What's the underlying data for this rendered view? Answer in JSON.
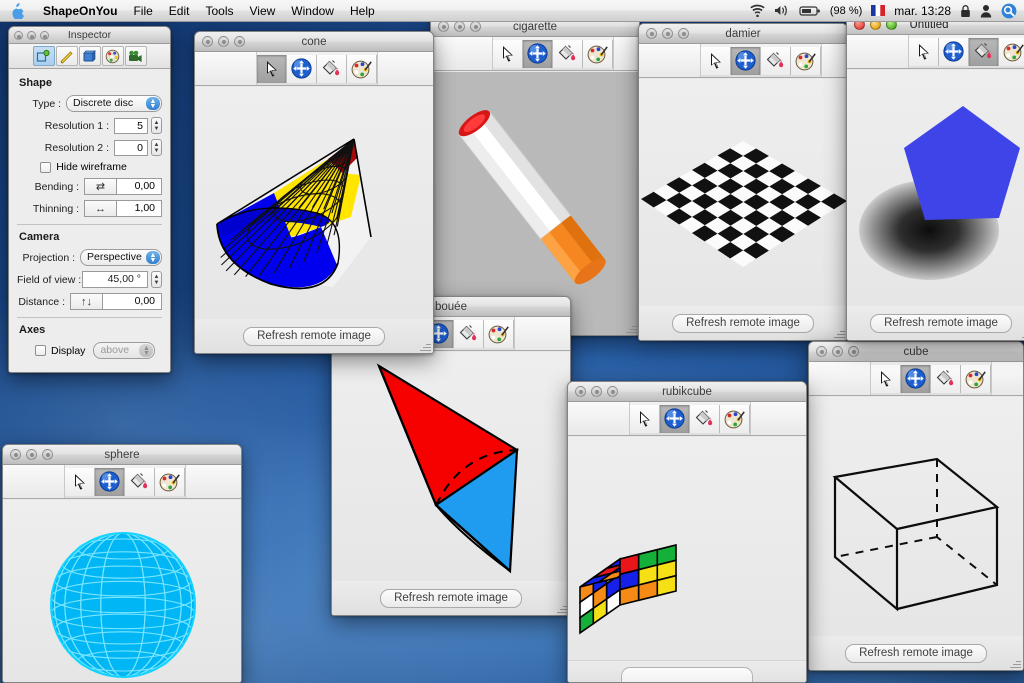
{
  "menubar": {
    "apple_icon": "apple-logo-icon",
    "app_name": "ShapeOnYou",
    "items": [
      "File",
      "Edit",
      "Tools",
      "View",
      "Window",
      "Help"
    ],
    "status": {
      "wifi_icon": "airport-wifi-icon",
      "volume_icon": "speaker-volume-icon",
      "battery_icon": "battery-icon",
      "battery_text": "(98 %)",
      "flag_icon": "french-flag-icon",
      "clock": "mar. 13:28",
      "lock_icon": "padlock-icon",
      "user_icon": "fast-user-switch-icon",
      "spotlight_icon": "spotlight-search-icon"
    }
  },
  "inspector": {
    "title": "Inspector",
    "tabs": [
      {
        "name": "shape-tab",
        "icon": "shape-geometry-icon",
        "selected": true
      },
      {
        "name": "ruler-tab",
        "icon": "pencil-ruler-icon",
        "selected": false
      },
      {
        "name": "material-tab",
        "icon": "blue-cube-icon",
        "selected": false
      },
      {
        "name": "colors-tab",
        "icon": "color-palette-icon",
        "selected": false
      },
      {
        "name": "render-tab",
        "icon": "movie-camera-icon",
        "selected": false
      }
    ],
    "shape": {
      "section": "Shape",
      "type_label": "Type :",
      "type_value": "Discrete disc",
      "res1_label": "Resolution 1 :",
      "res1_value": "5",
      "res2_label": "Resolution 2 :",
      "res2_value": "0",
      "hide_wireframe_label": "Hide wireframe",
      "hide_wireframe_checked": false,
      "bending_label": "Bending :",
      "bending_glyph": "⇄",
      "bending_value": "0,00",
      "thinning_label": "Thinning :",
      "thinning_glyph": "↔",
      "thinning_value": "1,00"
    },
    "camera": {
      "section": "Camera",
      "projection_label": "Projection :",
      "projection_value": "Perspective",
      "fov_label": "Field of view :",
      "fov_value": "45,00 °",
      "distance_label": "Distance :",
      "distance_glyph": "↑↓",
      "distance_value": "0,00"
    },
    "axes": {
      "section": "Axes",
      "display_label": "Display",
      "display_checked": false,
      "display_position": "above"
    }
  },
  "tools": [
    {
      "name": "select-arrow-tool",
      "icon": "cursor-arrow-icon"
    },
    {
      "name": "move-rotate-tool",
      "icon": "blue-compass-move-icon"
    },
    {
      "name": "paint-bucket-tool",
      "icon": "paint-bucket-icon"
    },
    {
      "name": "palette-brush-tool",
      "icon": "palette-brush-icon"
    }
  ],
  "refresh_label": "Refresh remote image",
  "windows": [
    {
      "title": "cone",
      "active": false,
      "selected_tool": 0,
      "shape": "cone-wireframe"
    },
    {
      "title": "cigarette",
      "active": false,
      "selected_tool": 1,
      "shape": "cigarette-cylinder"
    },
    {
      "title": "damier",
      "active": false,
      "selected_tool": 1,
      "shape": "checkerboard-plane"
    },
    {
      "title": "Untitled",
      "active": true,
      "selected_tool": 2,
      "shape": "blue-pentagon"
    },
    {
      "title": "bouée",
      "active": false,
      "selected_tool": 1,
      "shape": "red-blue-bicone"
    },
    {
      "title": "rubikcube",
      "active": false,
      "selected_tool": 1,
      "shape": "rubiks-cube"
    },
    {
      "title": "sphere",
      "active": false,
      "selected_tool": 1,
      "shape": "cyan-wireframe-sphere"
    },
    {
      "title": "cube",
      "active": false,
      "selected_tool": 1,
      "shape": "wireframe-cube"
    }
  ],
  "colors": {
    "accent_blue": "#3f44e8",
    "cone_yellow": "#ffe500",
    "cone_blue": "#0000ee",
    "cone_red": "#aa0000",
    "bouee_red": "#f70000",
    "bouee_blue": "#1f9cf0",
    "sphere_cyan": "#00c6ff",
    "cigarette_orange": "#f78a1e",
    "cigarette_red": "#e00000",
    "desktop_blue": "#1a4a8c"
  }
}
